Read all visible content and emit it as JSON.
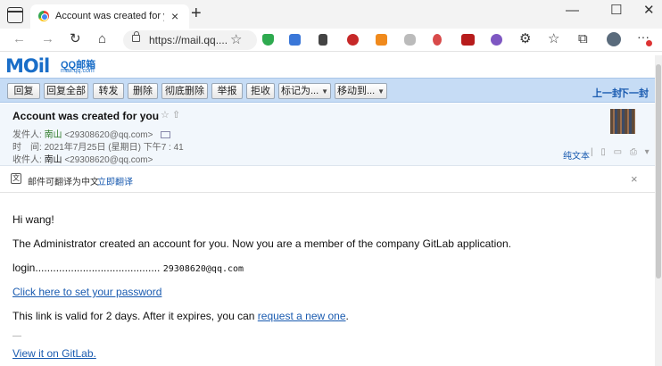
{
  "browser": {
    "tab_title": "Account was created for you - Q",
    "tab_close": "×",
    "new_tab": "+",
    "minimize": "—",
    "maximize": "☐",
    "close": "✕",
    "url": "https://mail.qq....",
    "menu": "···"
  },
  "mail_app": {
    "logo_text": "MOil",
    "logo_brand": "QQ邮箱",
    "logo_domain": "mail.qq.com"
  },
  "toolbar": {
    "buttons": [
      "回复",
      "回复全部",
      "转发",
      "删除",
      "彻底删除",
      "举报",
      "拒收",
      "标记为...",
      "移动到..."
    ],
    "prev": "上一封",
    "next": "下一封"
  },
  "message": {
    "subject": "Account was created for you",
    "subject_icons": "☆ ⇧",
    "from_label": "发件人:",
    "from_name": "南山",
    "from_email": "<29308620@qq.com>",
    "time_label": "时　间:",
    "time_value": "2021年7月25日 (星期日) 下午7 : 41",
    "to_label": "收件人:",
    "to_name": "南山",
    "to_email": "<29308620@qq.com>",
    "plain_text": "纯文本",
    "separator": "|"
  },
  "translate_bar": {
    "icon": "文",
    "text": "邮件可翻译为中文",
    "action": "立即翻译",
    "close": "×"
  },
  "body": {
    "greeting": "Hi wang!",
    "intro": "The Administrator created an account for you. Now you are a member of the company GitLab application.",
    "login_label": "login..........................................",
    "login_value": "29308620@qq.com",
    "set_password_link": "Click here to set your password",
    "validity_text": "This link is valid for 2 days. After it expires, you can ",
    "request_link": "request a new one",
    "validity_end": ".",
    "signature_dash": "—",
    "gitlab_link": "View it on GitLab."
  }
}
